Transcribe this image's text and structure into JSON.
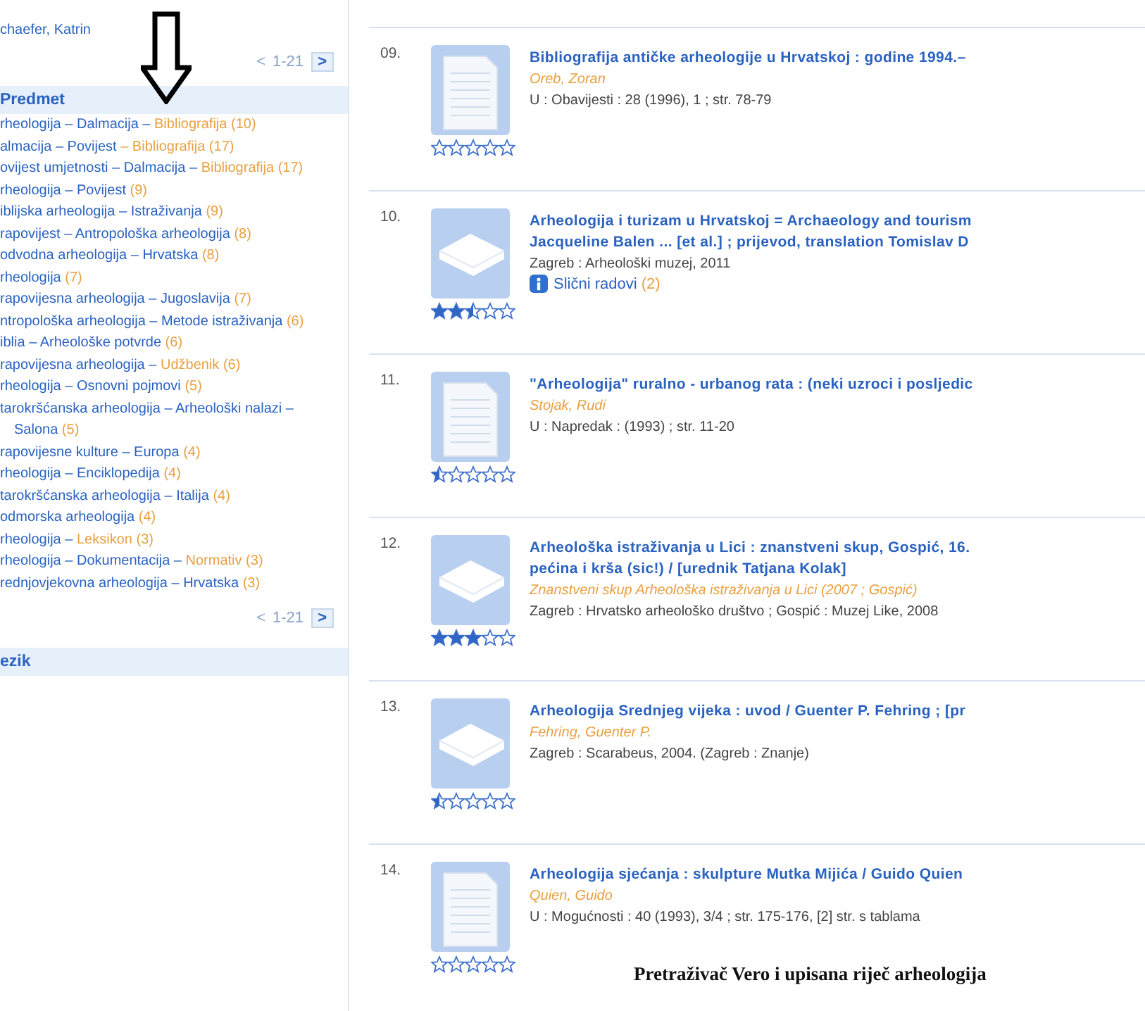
{
  "sidebar": {
    "author_tail": {
      "name": "chaefer, Katrin"
    },
    "pager_top": {
      "prev": "<",
      "range": "1-21",
      "next": ">"
    },
    "subject_facet": {
      "heading": "Predmet",
      "items": [
        {
          "term": "rheologija – Dalmacija –",
          "form": "Bibliografija",
          "count": "(10)"
        },
        {
          "term": "almacija – Povijest",
          "form": "– Bibliografija",
          "count": "(17)"
        },
        {
          "term": "ovijest umjetnosti – Dalmacija –",
          "form": "Bibliografija",
          "count": "(17)"
        },
        {
          "term": "rheologija – Povijest",
          "count": "(9)"
        },
        {
          "term": "iblijska arheologija – Istraživanja",
          "count": "(9)"
        },
        {
          "term": "rapovijest – Antropološka arheologija",
          "count": "(8)"
        },
        {
          "term": "odvodna arheologija – Hrvatska",
          "count": "(8)"
        },
        {
          "term": "rheologija",
          "count": "(7)"
        },
        {
          "term": "rapovijesna arheologija – Jugoslavija",
          "count": "(7)"
        },
        {
          "term": "ntropološka arheologija – Metode istraživanja",
          "count": "(6)"
        },
        {
          "term": "iblia – Arheološke potvrde",
          "count": "(6)"
        },
        {
          "term": "rapovijesna arheologija –",
          "form": "Udžbenik",
          "count": "(6)"
        },
        {
          "term": "rheologija – Osnovni pojmovi",
          "count": "(5)"
        },
        {
          "term": "tarokršćanska arheologija – Arheološki nalazi – Salona",
          "count": "(5)"
        },
        {
          "term": "rapovijesne kulture – Europa",
          "count": "(4)"
        },
        {
          "term": "rheologija – Enciklopedija",
          "count": "(4)"
        },
        {
          "term": "tarokršćanska arheologija – Italija",
          "count": "(4)"
        },
        {
          "term": "odmorska arheologija",
          "count": "(4)"
        },
        {
          "term": "rheologija –",
          "form": "Leksikon",
          "count": "(3)"
        },
        {
          "term": "rheologija – Dokumentacija –",
          "form": "Normativ",
          "count": "(3)"
        },
        {
          "term": "rednjovjekovna arheologija – Hrvatska",
          "count": "(3)"
        }
      ]
    },
    "pager_bottom": {
      "prev": "<",
      "range": "1-21",
      "next": ">"
    },
    "language_facet": {
      "heading": "ezik"
    }
  },
  "results": [
    {
      "number": "09.",
      "kind": "document",
      "stars": 0,
      "title_lines": [
        "Bibliografija antičke arheologije u Hrvatskoj : godine 1994.–"
      ],
      "author": "Oreb, Zoran",
      "publication": "U : Obavijesti : 28 (1996), 1 ; str. 78-79"
    },
    {
      "number": "10.",
      "kind": "book",
      "stars": 2.5,
      "title_lines": [
        "Arheologija i turizam u Hrvatskoj = Archaeology and tourism",
        "Jacqueline Balen ... [et al.] ; prijevod, translation Tomislav D"
      ],
      "publication": "Zagreb : Arheološki muzej, 2011",
      "similar": {
        "label": "Slični radovi",
        "count": "(2)"
      }
    },
    {
      "number": "11.",
      "kind": "document",
      "stars": 0.5,
      "title_lines": [
        "\"Arheologija\" ruralno - urbanog rata : (neki uzroci i posljedic"
      ],
      "author": "Stojak, Rudi",
      "publication": "U : Napredak : (1993) ; str. 11-20"
    },
    {
      "number": "12.",
      "kind": "book",
      "stars": 3,
      "title_lines": [
        "Arheološka istraživanja u Lici : znanstveni skup, Gospić, 16.",
        "pećina i krša (sic!) / [urednik Tatjana Kolak]"
      ],
      "author": "Znanstveni skup Arheološka istraživanja u Lici (2007 ; Gospić)",
      "publication": "Zagreb : Hrvatsko arheološko društvo ; Gospić : Muzej Like, 2008"
    },
    {
      "number": "13.",
      "kind": "book",
      "stars": 0.5,
      "title_lines": [
        "Arheologija Srednjeg vijeka : uvod / Guenter P. Fehring ; [pr"
      ],
      "author": "Fehring, Guenter P.",
      "publication": "Zagreb : Scarabeus, 2004. (Zagreb : Znanje)"
    },
    {
      "number": "14.",
      "kind": "document",
      "stars": 0,
      "title_lines": [
        "Arheologija sjećanja : skulpture Mutka Mijića / Guido Quien"
      ],
      "author": "Quien, Guido",
      "publication": "U : Mogućnosti : 40 (1993), 3/4 ; str. 175-176, [2] str. s tablama"
    }
  ],
  "caption": "Pretraživač Vero i upisana riječ arheologija"
}
